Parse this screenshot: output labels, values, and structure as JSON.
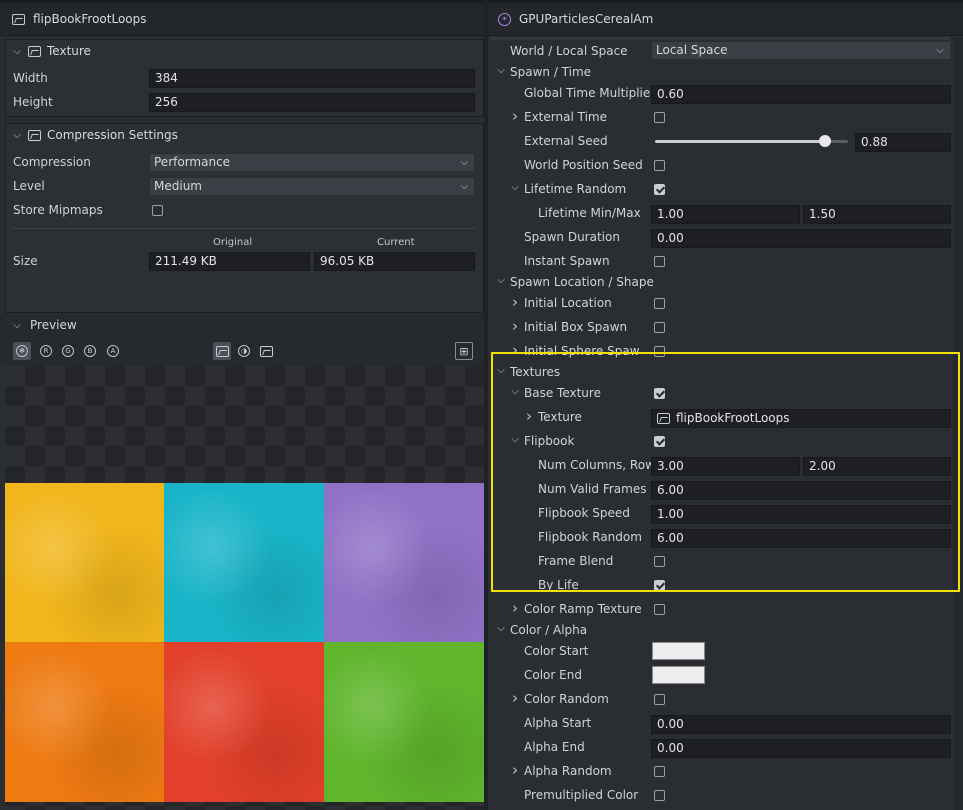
{
  "left": {
    "title": "flipBookFrootLoops",
    "texture_section": {
      "title": "Texture",
      "width_label": "Width",
      "width_value": "384",
      "height_label": "Height",
      "height_value": "256"
    },
    "compression_section": {
      "title": "Compression Settings",
      "compression_label": "Compression",
      "compression_value": "Performance",
      "level_label": "Level",
      "level_value": "Medium",
      "mipmaps_label": "Store Mipmaps",
      "mipmaps_checked": false,
      "col_original": "Original",
      "col_current": "Current",
      "size_label": "Size",
      "size_original": "211.49 KB",
      "size_current": "96.05 KB"
    },
    "preview": {
      "title": "Preview",
      "channel_buttons": [
        "R",
        "G",
        "B",
        "A"
      ],
      "tile_colors": [
        "#f1b61c",
        "#19b4c8",
        "#8f72c6",
        "#ee7a12",
        "#e2402a",
        "#5fb52c"
      ]
    }
  },
  "right": {
    "title": "GPUParticlesCerealAm",
    "world_local_label": "World / Local Space",
    "world_local_value": "Local Space",
    "spawn_time": {
      "title": "Spawn / Time",
      "global_time_label": "Global Time Multiplier",
      "global_time_value": "0.60",
      "external_time_label": "External Time",
      "external_seed_label": "External Seed",
      "external_seed_value": "0.88",
      "external_seed_fraction": 0.88,
      "world_pos_seed_label": "World Position Seed",
      "lifetime_random_label": "Lifetime Random",
      "lifetime_minmax_label": "Lifetime Min/Max",
      "lifetime_min": "1.00",
      "lifetime_max": "1.50",
      "spawn_duration_label": "Spawn Duration",
      "spawn_duration_value": "0.00",
      "instant_spawn_label": "Instant Spawn"
    },
    "spawn_location": {
      "title": "Spawn Location / Shape",
      "initial_location_label": "Initial Location",
      "initial_box_label": "Initial Box Spawn",
      "initial_sphere_label": "Initial Sphere Spaw"
    },
    "textures": {
      "title": "Textures",
      "base_texture_label": "Base Texture",
      "texture_label": "Texture",
      "texture_value": "flipBookFrootLoops",
      "flipbook_label": "Flipbook",
      "num_cols_label": "Num Columns, Row",
      "num_cols": "3.00",
      "num_rows": "2.00",
      "valid_frames_label": "Num Valid Frames",
      "valid_frames": "6.00",
      "speed_label": "Flipbook Speed",
      "speed": "1.00",
      "random_label": "Flipbook Random",
      "random": "6.00",
      "frame_blend_label": "Frame Blend",
      "by_life_label": "By Life"
    },
    "color_ramp_label": "Color Ramp Texture",
    "color_alpha": {
      "title": "Color / Alpha",
      "color_start_label": "Color Start",
      "color_start": "#eeeeee",
      "color_end_label": "Color End",
      "color_end": "#eeeeee",
      "color_random_label": "Color Random",
      "alpha_start_label": "Alpha Start",
      "alpha_start": "0.00",
      "alpha_end_label": "Alpha End",
      "alpha_end": "0.00",
      "alpha_random_label": "Alpha Random",
      "premult_label": "Premultiplied Color"
    }
  },
  "highlight_color": "#f2e000"
}
